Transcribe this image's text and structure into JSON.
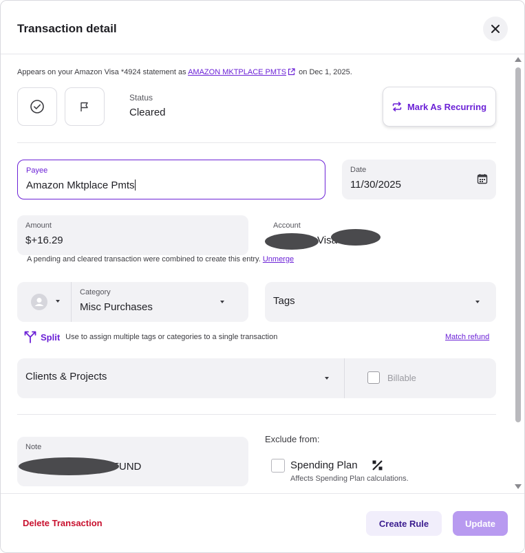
{
  "window": {
    "title": "Transaction detail"
  },
  "statement": {
    "prefix": "Appears on your Amazon Visa *4924 statement as",
    "merchant_link": "AMAZON MKTPLACE PMTS",
    "suffix": "on Dec 1, 2025."
  },
  "status": {
    "label": "Status",
    "value": "Cleared"
  },
  "recurring": {
    "label": "Mark As Recurring"
  },
  "payee": {
    "label": "Payee",
    "value": "Amazon Mktplace Pmts"
  },
  "date": {
    "label": "Date",
    "value": "11/30/2025"
  },
  "amount": {
    "label": "Amount",
    "currency": "$",
    "value": "+16.29"
  },
  "account": {
    "label": "Account",
    "value_visible": "Visa"
  },
  "merge_note": {
    "text": "A pending and cleared transaction were combined to create this entry.",
    "link": "Unmerge"
  },
  "category": {
    "label": "Category",
    "value": "Misc Purchases"
  },
  "tags": {
    "placeholder": "Tags"
  },
  "split": {
    "label": "Split",
    "description": "Use to assign multiple tags or categories to a single transaction",
    "match_refund": "Match refund"
  },
  "clients_projects": {
    "placeholder": "Clients & Projects",
    "billable_label": "Billable"
  },
  "note": {
    "label": "Note",
    "value_visible": "REFUND",
    "partial_visible": "pi"
  },
  "exclude": {
    "heading": "Exclude from:",
    "spending_plan_label": "Spending Plan",
    "spending_plan_desc": "Affects Spending Plan calculations."
  },
  "footer": {
    "delete_label": "Delete Transaction",
    "create_rule_label": "Create Rule",
    "update_label": "Update"
  },
  "colors": {
    "accent": "#6b21d6",
    "danger": "#c8102e",
    "update_disabled": "#b89af0"
  }
}
